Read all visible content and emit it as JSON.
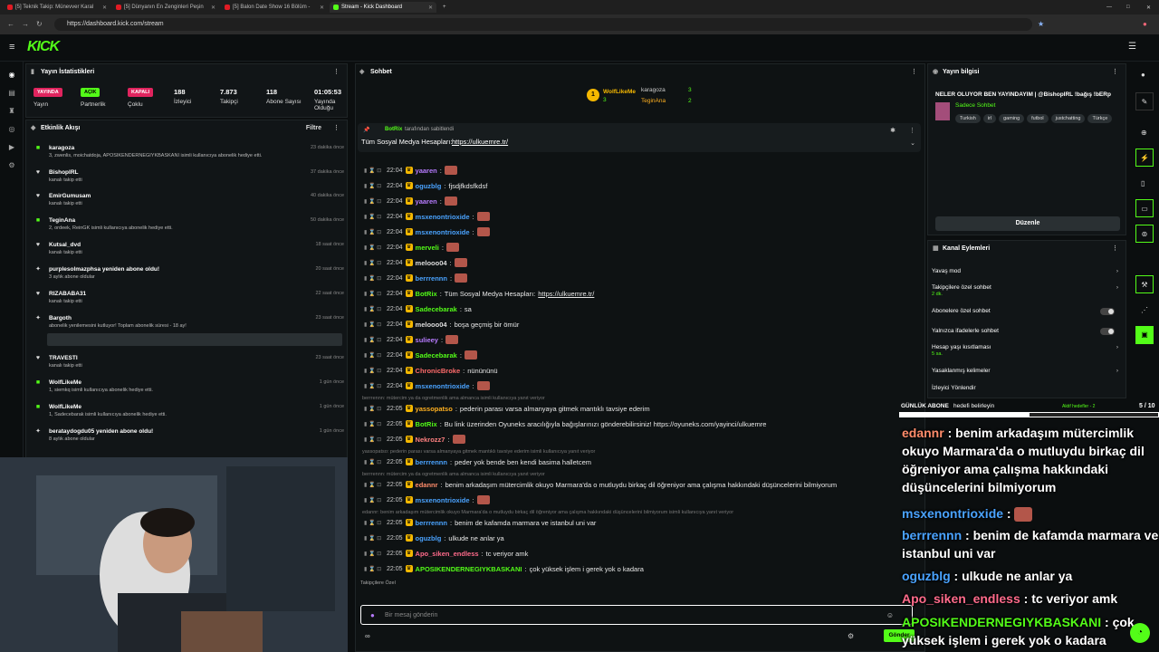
{
  "browser": {
    "tabs": [
      {
        "label": "[5] Teknik Takip: Münevver Karal"
      },
      {
        "label": "[5] Dünyanın En Zenginleri Peşin"
      },
      {
        "label": "[5] Balon Date Show 16 Bölüm -"
      },
      {
        "label": "Stream - Kick Dashboard"
      }
    ],
    "url": "https://dashboard.kick.com/stream"
  },
  "header": {
    "logo": "KICK"
  },
  "stats": {
    "title": "Yayın İstatistikleri",
    "items": [
      {
        "badge": "YAYINDA",
        "label": "Yayın",
        "color": "#e0245e"
      },
      {
        "badge": "AÇIK",
        "label": "Partnerlik",
        "color": "#53fc18"
      },
      {
        "badge": "KAPALI",
        "label": "Çoklu",
        "color": "#e0245e"
      },
      {
        "value": "188",
        "label": "İzleyici"
      },
      {
        "value": "7.873",
        "label": "Takipçi"
      },
      {
        "value": "118",
        "label": "Abone Sayısı"
      },
      {
        "value": "01:05:53",
        "label": "Yayında Olduğu"
      }
    ]
  },
  "activity": {
    "title": "Etkinlik Akışı",
    "filter": "Filtre",
    "items": [
      {
        "name": "karagoza",
        "sub": "3, zwenlis, moichatdoja, APOSIKENDERNEGIYKBASKANI isimli kullanıcıya abonelik hediye etti.",
        "time": "23 dakika önce",
        "icon": "gift"
      },
      {
        "name": "BishopIRL",
        "sub": "kanalı takip etti",
        "time": "37 dakika önce",
        "icon": "heart"
      },
      {
        "name": "EmirGumusam",
        "sub": "kanalı takip etti",
        "time": "40 dakika önce",
        "icon": "heart"
      },
      {
        "name": "TeginAna",
        "sub": "2, ordeek, ReinGK isimli kullanıcıya abonelik hediye etti.",
        "time": "50 dakika önce",
        "icon": "gift"
      },
      {
        "name": "Kutsal_dvd",
        "sub": "kanalı takip etti",
        "time": "18 saat önce",
        "icon": "heart"
      },
      {
        "name": "purplesolmazphsa yeniden abone oldu!",
        "sub": "3 aylık abone oldular",
        "time": "20 saat önce",
        "icon": "star"
      },
      {
        "name": "RIZABABA31",
        "sub": "kanalı takip etti",
        "time": "22 saat önce",
        "icon": "heart"
      },
      {
        "name": "Bargoth",
        "sub": "abonelik yenilemesini kutluyor! Toplam abonelik süresi - 18 ay!",
        "time": "23 saat önce",
        "icon": "star"
      },
      {
        "name": "TRAVESTI",
        "sub": "kanalı takip etti",
        "time": "23 saat önce",
        "icon": "heart"
      },
      {
        "name": "WolfLikeMe",
        "sub": "1, siemkq isimli kullanıcıya abonelik hediye etti.",
        "time": "1 gün önce",
        "icon": "gift"
      },
      {
        "name": "WolfLikeMe",
        "sub": "1, Sadecebarak isimli kullanıcıya abonelik hediye etti.",
        "time": "1 gün önce",
        "icon": "gift"
      },
      {
        "name": "berataydogdu05 yeniden abone oldu!",
        "sub": "8 aylık abone oldular",
        "time": "1 gün önce",
        "icon": "star"
      }
    ]
  },
  "chat": {
    "title": "Sohbet",
    "leaders": [
      {
        "name": "WolfLikeMe",
        "count": "3"
      },
      {
        "name": "karagoza",
        "count": "3"
      },
      {
        "name": "TeginAna",
        "count": "2"
      }
    ],
    "pinned": {
      "by": "BotRix",
      "by_suffix": "tarafından sabitlendi",
      "text": "Tüm Sosyal Medya Hesapları:",
      "link": "https://ulkuemre.tr/"
    },
    "messages": [
      {
        "time": "22:04",
        "user": "yaaren",
        "color": "#b77bff",
        "text": "",
        "emote": true
      },
      {
        "time": "22:04",
        "user": "oguzblg",
        "color": "#4aa3ff",
        "text": "fjsdjfkdsfkdsf",
        "emote": false
      },
      {
        "time": "22:04",
        "user": "yaaren",
        "color": "#b77bff",
        "text": "",
        "emote": true
      },
      {
        "time": "22:04",
        "user": "msxenontrioxide",
        "color": "#4aa3ff",
        "text": "",
        "emote": true
      },
      {
        "time": "22:04",
        "user": "msxenontrioxide",
        "color": "#4aa3ff",
        "text": "",
        "emote": true
      },
      {
        "time": "22:04",
        "user": "merveli",
        "color": "#53fc18",
        "text": "",
        "emote": true
      },
      {
        "time": "22:04",
        "user": "melooo04",
        "color": "#dddddd",
        "text": "",
        "emote": true
      },
      {
        "time": "22:04",
        "user": "berrrennn",
        "color": "#4aa3ff",
        "text": "",
        "emote": true
      },
      {
        "time": "22:04",
        "user": "BotRix",
        "color": "#53fc18",
        "text": "Tüm Sosyal Medya Hesapları:",
        "link": "https://ulkuemre.tr/"
      },
      {
        "time": "22:04",
        "user": "Sadecebarak",
        "color": "#53fc18",
        "text": "sa",
        "emote": false
      },
      {
        "time": "22:04",
        "user": "melooo04",
        "color": "#dddddd",
        "text": "boşa geçmiş bir ömür",
        "emote": false
      },
      {
        "time": "22:04",
        "user": "sulieey",
        "color": "#b77bff",
        "text": "",
        "emote": true
      },
      {
        "time": "22:04",
        "user": "Sadecebarak",
        "color": "#53fc18",
        "text": "",
        "emote": true
      },
      {
        "time": "22:04",
        "user": "ChronicBroke",
        "color": "#ff6b6b",
        "text": "nünününü",
        "emote": false
      },
      {
        "time": "22:04",
        "user": "msxenontrioxide",
        "color": "#4aa3ff",
        "text": "",
        "emote": true
      }
    ],
    "messages2": [
      {
        "reply": "berrrennn: mütercim ya da ogretmenlik ama almanca isimli kullanıcıya yanıt veriyor",
        "time": "22:05",
        "user": "yassopatso",
        "color": "#ffb020",
        "text": "pederin parası varsa almanyaya gitmek mantıklı tavsiye ederim"
      },
      {
        "reply": "",
        "time": "22:05",
        "user": "BotRix",
        "color": "#53fc18",
        "text": "Bu link üzerinden Oyuneks aracılığıyla bağışlarınızı gönderebilirsiniz! https://oyuneks.com/yayinci/ulkuemre"
      },
      {
        "reply": "",
        "time": "22:05",
        "user": "Nekrozz7",
        "color": "#ff8080",
        "text": ""
      },
      {
        "reply": "yassopatso: pederin parası varsa almanyaya gitmek mantıklı tavsiye ederim isimli kullanıcıya yanıt veriyor",
        "time": "22:05",
        "user": "berrrennn",
        "color": "#4aa3ff",
        "text": "peder yok bende ben kendi basima halletcem"
      },
      {
        "reply": "berrrennn: mütercim ya da ogretmenlik ama almanca isimli kullanıcıya yanıt veriyor",
        "time": "22:05",
        "user": "edannr",
        "color": "#ff8c6b",
        "text": "benim arkadaşım mütercimlik okuyo Marmara'da o mutluydu birkaç dil öğreniyor ama çalışma hakkındaki düşüncelerini bilmiyorum"
      },
      {
        "reply": "",
        "time": "22:05",
        "user": "msxenontrioxide",
        "color": "#4aa3ff",
        "text": ""
      },
      {
        "reply": "edannr: benim arkadaşım mütercimlik okuyo Marmara'da o mutluydu birkaç dil öğreniyor ama çalışma hakkındaki düşüncelerini bilmiyorum isimli kullanıcıya yanıt veriyor",
        "time": "22:05",
        "user": "berrrennn",
        "color": "#4aa3ff",
        "text": "benim de kafamda marmara ve istanbul uni var"
      },
      {
        "reply": "",
        "time": "22:05",
        "user": "oguzblg",
        "color": "#4aa3ff",
        "text": "ulkude ne anlar ya"
      },
      {
        "reply": "",
        "time": "22:05",
        "user": "Apo_siken_endless",
        "color": "#ff6b8b",
        "text": "tc veriyor amk"
      },
      {
        "reply": "",
        "time": "22:05",
        "user": "APOSIKENDERNEGIYKBASKANI",
        "color": "#53fc18",
        "text": "çok yüksek işlem i gerek yok o kadara"
      }
    ],
    "followers_only": "Takipçilere Özel",
    "input_placeholder": "Bir mesaj gönderin",
    "send": "Gönder"
  },
  "info": {
    "title": "Yayın bilgisi",
    "stream_title": "NELER OLUYOR BEN YAYINDAYIM | @BishopIRL !bağış !bERp",
    "category": "Sadece Sohbet",
    "tags": [
      "Turkish",
      "irl",
      "gaming",
      "futbol",
      "justchatting",
      "Türkçe"
    ],
    "edit": "Düzenle"
  },
  "actions": {
    "title": "Kanal Eylemleri",
    "items": [
      {
        "label": "Yavaş mod",
        "sub": "",
        "type": "chev"
      },
      {
        "label": "Takipçilere özel sohbet",
        "sub": "2 dk.",
        "type": "chev"
      },
      {
        "label": "Abonelere özel sohbet",
        "sub": "",
        "type": "toggle"
      },
      {
        "label": "Yalnızca ifadelerle sohbet",
        "sub": "",
        "type": "toggle"
      },
      {
        "label": "Hesap yaşı kısıtlaması",
        "sub": "5 sa.",
        "type": "chev"
      },
      {
        "label": "Yasaklanmış kelimeler",
        "sub": "",
        "type": "chev"
      },
      {
        "label": "İzleyici Yönlendir",
        "sub": "",
        "type": "none"
      }
    ]
  },
  "goal": {
    "label": "GÜNLÜK ABONE",
    "sub": "hedefi belirleyin",
    "active": "Aktif hedefler - 2",
    "progress": "5 / 10",
    "fraction": 0.5
  },
  "overlay": {
    "lines": [
      {
        "user": "edannr",
        "color": "#ff8c6b",
        "text": "benim arkadaşım mütercimlik okuyo Marmara'da o mutluydu birkaç dil öğreniyor ama çalışma hakkındaki düşüncelerini bilmiyorum"
      },
      {
        "user": "msxenontrioxide",
        "color": "#4aa3ff",
        "text": ""
      },
      {
        "user": "berrrennn",
        "color": "#4aa3ff",
        "text": "benim de kafamda marmara ve istanbul uni var"
      },
      {
        "user": "oguzblg",
        "color": "#4aa3ff",
        "text": "ulkude ne anlar ya"
      },
      {
        "user": "Apo_siken_endless",
        "color": "#ff6b8b",
        "text": "tc veriyor amk"
      },
      {
        "user": "APOSIKENDERNEGIYKBASKANI",
        "color": "#53fc18",
        "text": "çok yüksek işlem i gerek yok o kadara"
      }
    ]
  }
}
